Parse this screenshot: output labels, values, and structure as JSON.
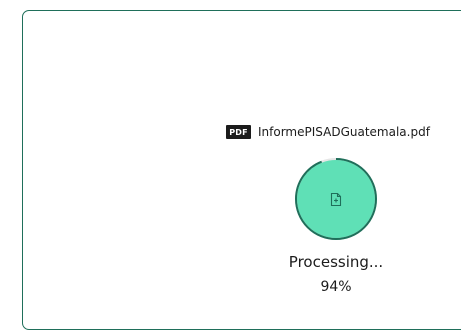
{
  "file": {
    "type_badge": "PDF",
    "name": "InformePISADGuatemala.pdf"
  },
  "progress": {
    "status": "Processing...",
    "percent_label": "94%",
    "fraction": 0.94
  },
  "icons": {
    "file_type": "pdf-badge-icon",
    "center": "file-plus-icon"
  },
  "colors": {
    "panel_border": "#1f6f5a",
    "ring_fill": "#5fe0b6",
    "ring_stroke": "#1f6f5a",
    "ring_track": "#e6e6e6"
  }
}
